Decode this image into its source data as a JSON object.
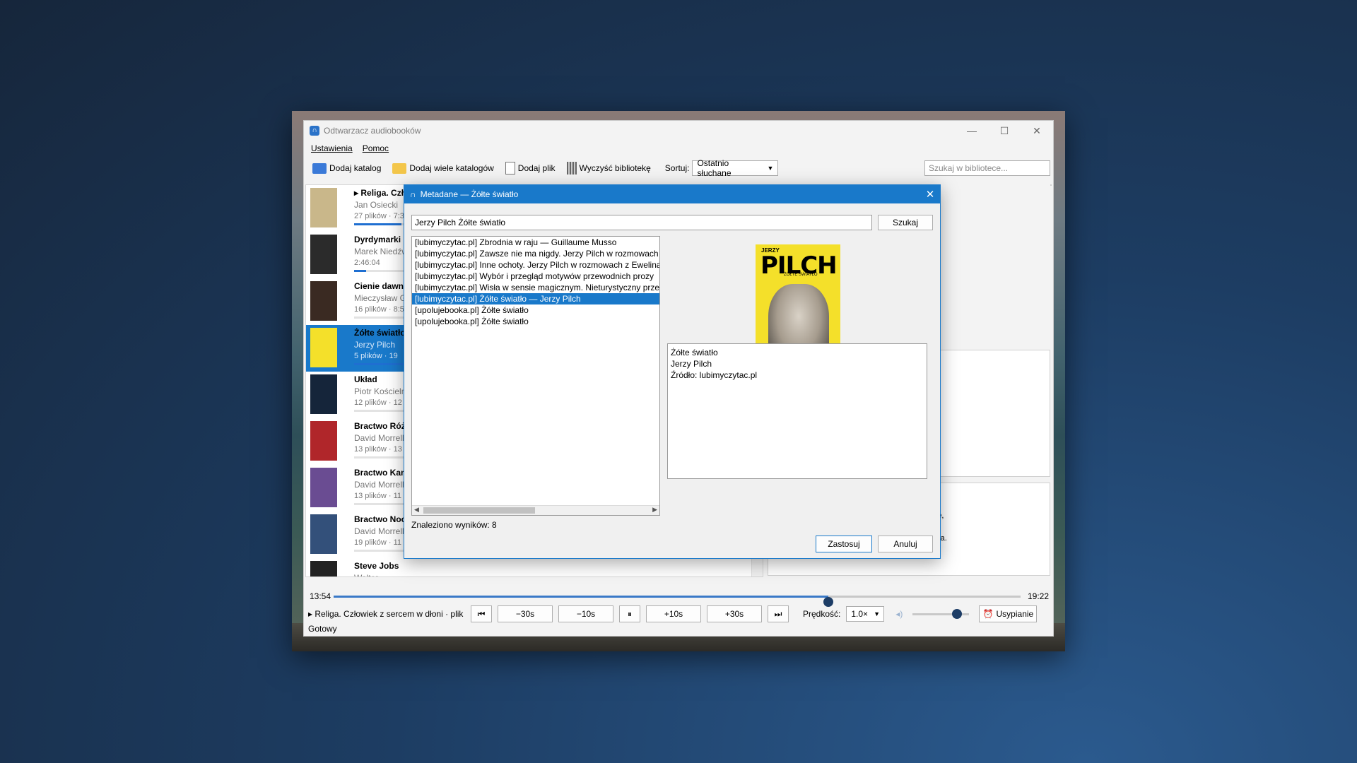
{
  "window": {
    "title": "Odtwarzacz audiobooków"
  },
  "menu": {
    "settings": "Ustawienia",
    "help": "Pomoc"
  },
  "toolbar": {
    "add_folder": "Dodaj katalog",
    "add_many": "Dodaj wiele katalogów",
    "add_file": "Dodaj plik",
    "clear": "Wyczyść bibliotekę",
    "sort_label": "Sortuj:",
    "sort_value": "Ostatnio słuchane",
    "search_placeholder": "Szukaj w bibliotece..."
  },
  "library": [
    {
      "title": "▸ Religa. Czło",
      "author": "Jan Osiecki",
      "info": "27 plików · 7:3",
      "progress": 0.12,
      "cover": "#c9b78a"
    },
    {
      "title": "Dyrdymarki",
      "author": "Marek Niedźw",
      "info": "2:46:04",
      "progress": 0.03,
      "cover": "#2b2b2b"
    },
    {
      "title": "Cienie dawny",
      "author": "Mieczysław G",
      "info": "16 plików · 8:5",
      "progress": 0.0,
      "cover": "#3a2a22"
    },
    {
      "title": "Żółte światło",
      "author": "Jerzy Pilch",
      "info": "5 plików · 19",
      "progress": 0.7,
      "cover": "#f4e02a"
    },
    {
      "title": "Układ",
      "author": "Piotr Kościeln",
      "info": "12 plików · 12",
      "progress": 0.0,
      "cover": "#15253a"
    },
    {
      "title": "Bractwo Róż",
      "author": "David Morrell",
      "info": "13 plików · 13",
      "progress": 0.0,
      "cover": "#b0262a"
    },
    {
      "title": "Bractwo Kam",
      "author": "David Morrell",
      "info": "13 plików · 11",
      "progress": 0.0,
      "cover": "#6a4c92"
    },
    {
      "title": "Bractwo Noc",
      "author": "David Morrell",
      "info": "19 plików · 11",
      "progress": 0.0,
      "cover": "#33507a"
    },
    {
      "title": "Steve Jobs",
      "author": "Walter",
      "info": "",
      "progress": 0.0,
      "cover": "#222222"
    }
  ],
  "right_panel": {
    "description": "składa się ze złudzenia\nnia. „Żółte światło” łączy\nytycznymi. Pilch eksploruje,\nrchczasową twórczość,\nroza zgubna i uzależniająca."
  },
  "player": {
    "current_time": "13:54",
    "total_time": "19:22",
    "position": 0.72,
    "now_playing": "▸ Religa. Człowiek z sercem w dłoni · plik",
    "back30": "−30s",
    "back10": "−10s",
    "fwd10": "+10s",
    "fwd30": "+30s",
    "speed_label": "Prędkość:",
    "speed_value": "1.0×",
    "volume": 0.78,
    "sleep": "Usypianie"
  },
  "status": "Gotowy",
  "dialog": {
    "title": "Metadane — Żółte światło",
    "query": "Jerzy Pilch Żółte światło",
    "search": "Szukaj",
    "results": [
      "[lubimyczytac.pl] Zbrodnia w raju — Guillaume Musso",
      "[lubimyczytac.pl] Zawsze nie ma nigdy. Jerzy Pilch w rozmowach",
      "[lubimyczytac.pl] Inne ochoty. Jerzy Pilch w rozmowach z Ewelina",
      "[lubimyczytac.pl] Wybór i przegląd motywów przewodnich prozy",
      "[lubimyczytac.pl] Wisła w sensie magicznym. Nieturystyczny prze",
      "[lubimyczytac.pl] Żółte światło — Jerzy Pilch",
      "[upolujebooka.pl] Żółte światło",
      "[upolujebooka.pl] Żółte światło"
    ],
    "selected_index": 5,
    "found": "Znaleziono wyników: 8",
    "cover": {
      "author": "JERZY",
      "name": "PILCH",
      "subtitle": "ŻÓŁTE ŚWIATŁO"
    },
    "meta_title": "Żółte światło",
    "meta_author": "Jerzy Pilch",
    "meta_source": "Źródło: lubimyczytac.pl",
    "apply": "Zastosuj",
    "cancel": "Anuluj"
  }
}
